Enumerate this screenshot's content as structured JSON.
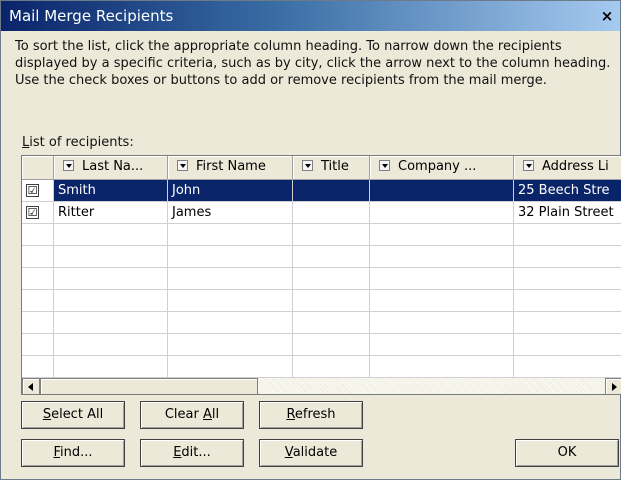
{
  "window": {
    "title": "Mail Merge Recipients",
    "close_glyph": "×"
  },
  "instructions": "To sort the list, click the appropriate column heading.  To narrow down the recipients displayed by a specific criteria, such as by city, click the arrow next to the column heading.  Use the check boxes or buttons to add or remove recipients from the mail merge.",
  "list_label": {
    "accel": "L",
    "rest": "ist of recipients:"
  },
  "table": {
    "columns": [
      "Last Na...",
      "First Name",
      "Title",
      "Company ...",
      "Address Li"
    ],
    "rows": [
      {
        "checked": true,
        "selected": true,
        "cells": [
          "Smith",
          "John",
          "",
          "",
          "25 Beech Stre"
        ]
      },
      {
        "checked": true,
        "selected": false,
        "cells": [
          "Ritter",
          "James",
          "",
          "",
          "32 Plain Street"
        ]
      }
    ],
    "check_glyph": "☑"
  },
  "buttons": {
    "select_all": {
      "accel": "S",
      "rest": "elect All"
    },
    "clear_all": {
      "pre": "Clear ",
      "accel": "A",
      "rest": "ll"
    },
    "refresh": {
      "accel": "R",
      "rest": "efresh"
    },
    "find": {
      "accel": "F",
      "rest": "ind..."
    },
    "edit": {
      "accel": "E",
      "rest": "dit..."
    },
    "validate": {
      "accel": "V",
      "rest": "alidate"
    },
    "ok": "OK"
  },
  "colors": {
    "selection": "#0a246a",
    "dialog_bg": "#ece9d8"
  }
}
